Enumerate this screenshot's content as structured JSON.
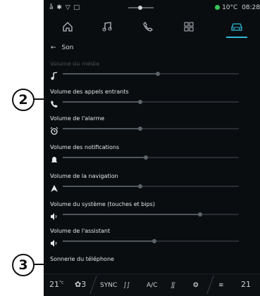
{
  "status": {
    "left_icons": "å ✱ ▽ □",
    "temperature": "10°C",
    "time": "08:28"
  },
  "tabs": [
    {
      "icon": "home-icon"
    },
    {
      "icon": "music-icon"
    },
    {
      "icon": "phone-icon"
    },
    {
      "icon": "apps-icon"
    },
    {
      "icon": "car-icon",
      "active": true
    }
  ],
  "header": {
    "back_label": "Son"
  },
  "items": [
    {
      "label": "Volume du média",
      "icon": "music-note-icon",
      "level": 0.54
    },
    {
      "label": "Volume des appels entrants",
      "icon": "phone-icon",
      "level": 0.44
    },
    {
      "label": "Volume de l'alarme",
      "icon": "alarm-icon",
      "level": 0.44
    },
    {
      "label": "Volume des notifications",
      "icon": "bell-icon",
      "level": 0.47
    },
    {
      "label": "Volume de la navigation",
      "icon": "navigation-arrow-icon",
      "level": 0.44
    },
    {
      "label": "Volume du système (touches et bips)",
      "icon": "speaker-icon",
      "level": 0.78
    },
    {
      "label": "Volume de l'assistant",
      "icon": "speaker-icon",
      "level": 0.52
    },
    {
      "label": "Sonnerie du téléphone"
    }
  ],
  "bottom": {
    "temp_left": "21",
    "temp_unit": "°c",
    "fan_speed": "3",
    "sync": "SYNC",
    "ac": "A/C",
    "temp_right": "21"
  },
  "callouts": {
    "two": "2",
    "three": "3"
  },
  "colors": {
    "accent": "#2fb8d8",
    "status_green": "#35c759"
  }
}
